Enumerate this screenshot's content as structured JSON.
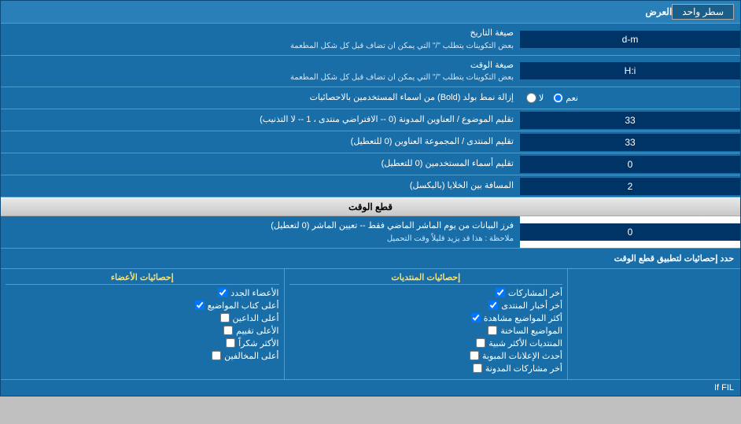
{
  "header": {
    "title": "العرض",
    "dropdown_label": "سطر واحد"
  },
  "rows": [
    {
      "id": "date_format",
      "label": "صيغة التاريخ",
      "sub_label": "بعض التكوينات يتطلب \"/\" التي يمكن ان تضاف قبل كل شكل المطعمة",
      "value": "d-m"
    },
    {
      "id": "time_format",
      "label": "صيغة الوقت",
      "sub_label": "بعض التكوينات يتطلب \"/\" التي يمكن ان تضاف قبل كل شكل المطعمة",
      "value": "H:i"
    },
    {
      "id": "bold_remove",
      "label": "إزالة نمط بولد (Bold) من اسماء المستخدمين بالاحصائيات",
      "is_radio": true,
      "options": [
        "نعم",
        "لا"
      ],
      "selected": "نعم"
    },
    {
      "id": "topic_title_trim",
      "label": "تقليم الموضوع / العناوين المدونة (0 -- الافتراضي منتدى ، 1 -- لا التذنيب)",
      "value": "33"
    },
    {
      "id": "forum_title_trim",
      "label": "تقليم المنتدى / المجموعة العناوين (0 للتعطيل)",
      "value": "33"
    },
    {
      "id": "username_trim",
      "label": "تقليم أسماء المستخدمين (0 للتعطيل)",
      "value": "0"
    },
    {
      "id": "cell_spacing",
      "label": "المسافة بين الخلايا (بالبكسل)",
      "value": "2"
    }
  ],
  "section_cutoff": {
    "title": "قطع الوقت"
  },
  "cutoff_row": {
    "label": "فرز البيانات من يوم الماشر الماضي فقط -- تعيين الماشر (0 لتعطيل)",
    "note": "ملاحظة : هذا قد يزيد قليلاً وقت التحميل",
    "value": "0"
  },
  "apply_cutoff": {
    "label": "حدد إحصائيات لتطبيق قطع الوقت"
  },
  "bottom_columns": [
    {
      "title": "",
      "items": []
    },
    {
      "title": "إحصائيات المنتديات",
      "items": [
        "أخر المشاركات",
        "أخر أخبار المنتدى",
        "أكثر المواضيع مشاهدة",
        "المواضيع الساخنة",
        "المنتديات الأكثر شبية",
        "أحدث الإعلانات المبوبة",
        "أخر مشاركات المدونة"
      ]
    },
    {
      "title": "إحصائيات الأعضاء",
      "items": [
        "الأعضاء الجدد",
        "أعلى كتاب المواضيع",
        "أعلى الداعين",
        "الأعلى تقييم",
        "الأكثر شكراً",
        "أعلى المخالفين"
      ]
    }
  ],
  "checkboxes_checked": {
    "اخر المشاركات": true,
    "أخر أخبار المنتدى": true,
    "أكثر المواضيع مشاهدة": true,
    "المواضيع الساخنة": false,
    "المنتديات الأكثر شبية": false,
    "أحدث الإعلانات المبوبة": false,
    "أخر مشاركات المدونة": false,
    "الأعضاء الجدد": true,
    "أعلى كتاب المواضيع": true,
    "أعلى الداعين": false,
    "الأعلى تقييم": false,
    "الأكثر شكراً": false,
    "أعلى المخالفين": false
  },
  "footer_note": "If FIL"
}
